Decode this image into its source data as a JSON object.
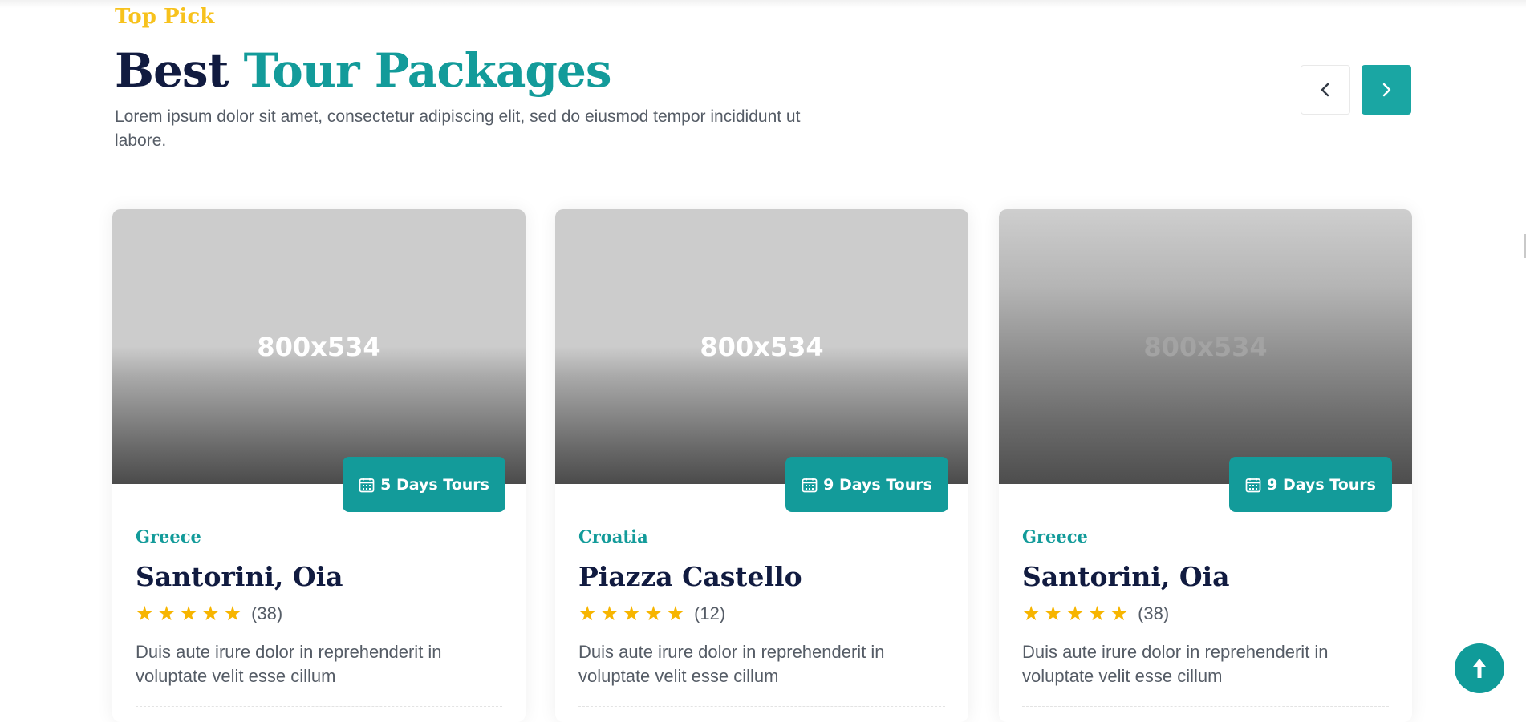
{
  "section": {
    "eyebrow": "Top Pick",
    "title_part1": "Best",
    "title_part2": "Tour Packages",
    "subtitle": "Lorem ipsum dolor sit amet, consectetur adipiscing elit, sed do eiusmod tempor incididunt ut labore."
  },
  "carousel_nav": {
    "prev_icon": "chevron-left-icon",
    "next_icon": "chevron-right-icon"
  },
  "cards": [
    {
      "image_label": "800x534",
      "badge_label": "5 Days Tours",
      "country": "Greece",
      "place": "Santorini, Oia",
      "rating_stars": 5,
      "review_count": "(38)",
      "description": "Duis aute irure dolor in reprehenderit in voluptate velit esse cillum"
    },
    {
      "image_label": "800x534",
      "badge_label": "9 Days Tours",
      "country": "Croatia",
      "place": "Piazza Castello",
      "rating_stars": 5,
      "review_count": "(12)",
      "description": "Duis aute irure dolor in reprehenderit in voluptate velit esse cillum"
    },
    {
      "image_label": "800x534",
      "badge_label": "9 Days Tours",
      "country": "Greece",
      "place": "Santorini, Oia",
      "rating_stars": 5,
      "review_count": "(38)",
      "description": "Duis aute irure dolor in reprehenderit in voluptate velit esse cillum"
    }
  ],
  "colors": {
    "accent_teal": "#139b9a",
    "eyebrow_yellow": "#f7c21d",
    "heading_navy": "#111b40",
    "star_gold": "#f7b500"
  },
  "scroll_top_icon": "arrow-up-icon"
}
